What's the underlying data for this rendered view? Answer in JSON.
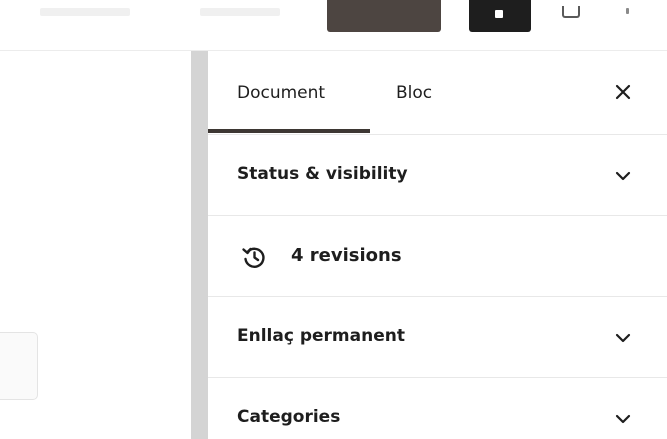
{
  "sidebar": {
    "tabs": [
      {
        "label": "Document",
        "active": true
      },
      {
        "label": "Bloc",
        "active": false
      }
    ],
    "panels": {
      "status_visibility": "Status & visibility",
      "revisions": "4 revisions",
      "permalink": "Enllaç permanent",
      "categories": "Categories"
    }
  },
  "icons": {
    "close": "close-icon",
    "chevron": "chevron-down-icon",
    "history": "history-icon",
    "settings": "settings-icon",
    "more": "more-vertical-icon"
  },
  "colors": {
    "accent": "#3d3733",
    "preview_button": "#4d4541",
    "update_button": "#1e1e1e",
    "divider": "#e8e8e8",
    "scrollbar": "#d4d4d4"
  }
}
